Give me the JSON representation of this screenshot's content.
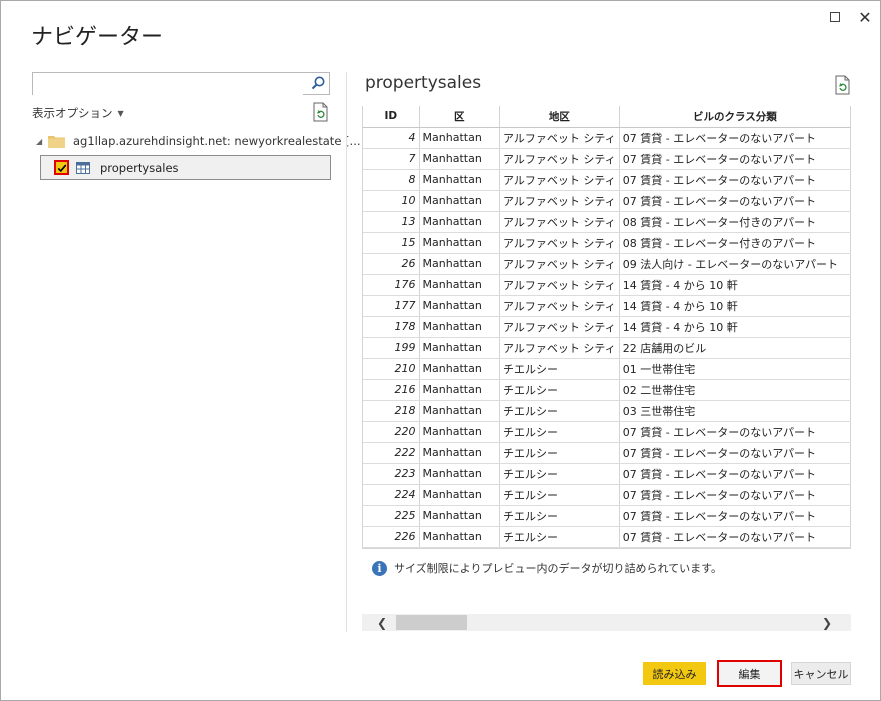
{
  "window": {
    "title": "ナビゲーター"
  },
  "left": {
    "search_value": "",
    "display_options": "表示オプション",
    "tree_root": "ag1llap.azurehdinsight.net: newyorkrealestate [...",
    "tree_item": "propertysales",
    "tree_item_checked": true
  },
  "preview": {
    "title": "propertysales",
    "columns": [
      "ID",
      "区",
      "地区",
      "ビルのクラス分類"
    ],
    "rows": [
      [
        "4",
        "Manhattan",
        "アルファベット シティ",
        "07 賃貸 - エレベーターのないアパート"
      ],
      [
        "7",
        "Manhattan",
        "アルファベット シティ",
        "07 賃貸 - エレベーターのないアパート"
      ],
      [
        "8",
        "Manhattan",
        "アルファベット シティ",
        "07 賃貸 - エレベーターのないアパート"
      ],
      [
        "10",
        "Manhattan",
        "アルファベット シティ",
        "07 賃貸 - エレベーターのないアパート"
      ],
      [
        "13",
        "Manhattan",
        "アルファベット シティ",
        "08 賃貸 - エレベーター付きのアパート"
      ],
      [
        "15",
        "Manhattan",
        "アルファベット シティ",
        "08 賃貸 - エレベーター付きのアパート"
      ],
      [
        "26",
        "Manhattan",
        "アルファベット シティ",
        "09 法人向け - エレベーターのないアパート"
      ],
      [
        "176",
        "Manhattan",
        "アルファベット シティ",
        "14 賃貸 - 4 から 10 軒"
      ],
      [
        "177",
        "Manhattan",
        "アルファベット シティ",
        "14 賃貸 - 4 から 10 軒"
      ],
      [
        "178",
        "Manhattan",
        "アルファベット シティ",
        "14 賃貸 - 4 から 10 軒"
      ],
      [
        "199",
        "Manhattan",
        "アルファベット シティ",
        "22 店舗用のビル"
      ],
      [
        "210",
        "Manhattan",
        "チエルシー",
        "01 一世帯住宅"
      ],
      [
        "216",
        "Manhattan",
        "チエルシー",
        "02 二世帯住宅"
      ],
      [
        "218",
        "Manhattan",
        "チエルシー",
        "03 三世帯住宅"
      ],
      [
        "220",
        "Manhattan",
        "チエルシー",
        "07 賃貸 - エレベーターのないアパート"
      ],
      [
        "222",
        "Manhattan",
        "チエルシー",
        "07 賃貸 - エレベーターのないアパート"
      ],
      [
        "223",
        "Manhattan",
        "チエルシー",
        "07 賃貸 - エレベーターのないアパート"
      ],
      [
        "224",
        "Manhattan",
        "チエルシー",
        "07 賃貸 - エレベーターのないアパート"
      ],
      [
        "225",
        "Manhattan",
        "チエルシー",
        "07 賃貸 - エレベーターのないアパート"
      ],
      [
        "226",
        "Manhattan",
        "チエルシー",
        "07 賃貸 - エレベーターのないアパート"
      ]
    ],
    "info": "サイズ制限によりプレビュー内のデータが切り詰められています。"
  },
  "buttons": {
    "load": "読み込み",
    "edit": "編集",
    "cancel": "キャンセル"
  },
  "colors": {
    "accent": "#f2c811",
    "highlight": "#e00000",
    "info": "#3a73b8"
  }
}
